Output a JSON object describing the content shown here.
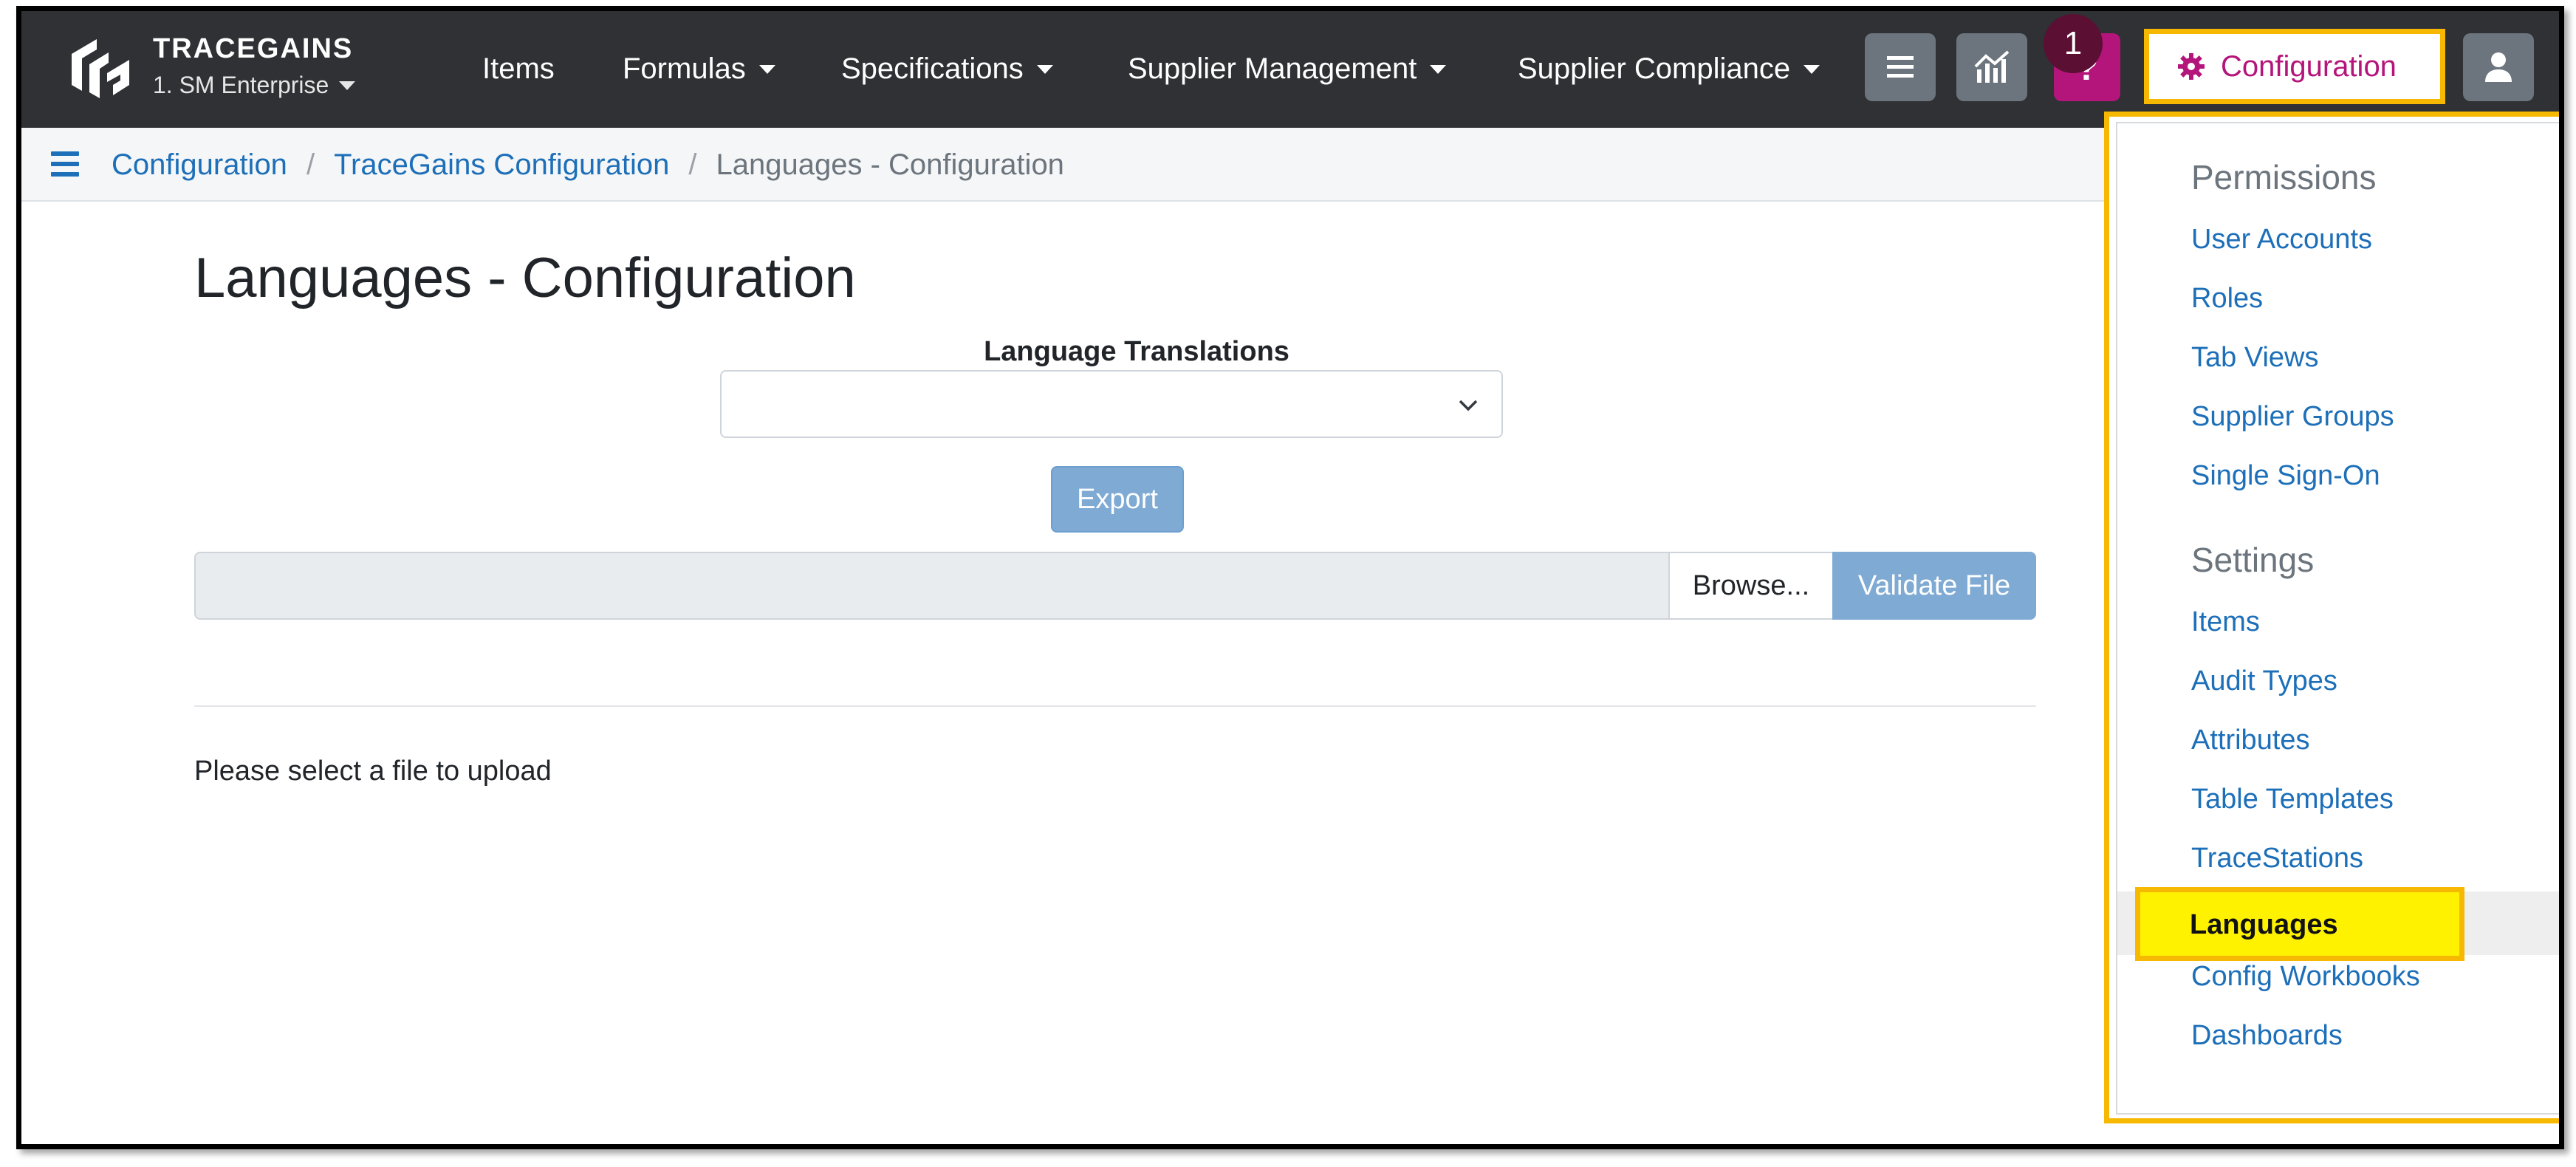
{
  "brand": {
    "name": "TRACEGAINS",
    "org": "1. SM Enterprise",
    "logo_icon": "tracegains-logo-icon"
  },
  "nav": {
    "items": [
      "Items",
      "Formulas",
      "Specifications",
      "Supplier Management",
      "Supplier Compliance"
    ],
    "list_icon": "list-icon",
    "analytics_icon": "analytics-chart-icon",
    "help_label": "?",
    "notification_count": "1",
    "configuration_label": "Configuration",
    "configuration_icon": "gear-icon",
    "user_icon": "user-icon"
  },
  "breadcrumb": {
    "items": [
      "Configuration",
      "TraceGains Configuration"
    ],
    "current": "Languages - Configuration",
    "separator": "/"
  },
  "page": {
    "title": "Languages - Configuration",
    "field_label": "Language Translations",
    "select_value": "",
    "export_label": "Export",
    "browse_label": "Browse...",
    "validate_label": "Validate File",
    "upload_message": "Please select a file to upload"
  },
  "dropdown": {
    "permissions_header": "Permissions",
    "permissions": [
      "User Accounts",
      "Roles",
      "Tab Views",
      "Supplier Groups",
      "Single Sign-On"
    ],
    "settings_header": "Settings",
    "settings": [
      "Items",
      "Audit Types",
      "Attributes",
      "Table Templates",
      "TraceStations",
      "Languages",
      "Config Workbooks",
      "Dashboards"
    ]
  },
  "colors": {
    "navbar": "#2f3134",
    "accent_magenta": "#b4157a",
    "link_blue": "#1c6fb8",
    "highlight_yellow": "#fff200",
    "highlight_border": "#f6b800",
    "button_blue_disabled": "#7eaad4"
  }
}
